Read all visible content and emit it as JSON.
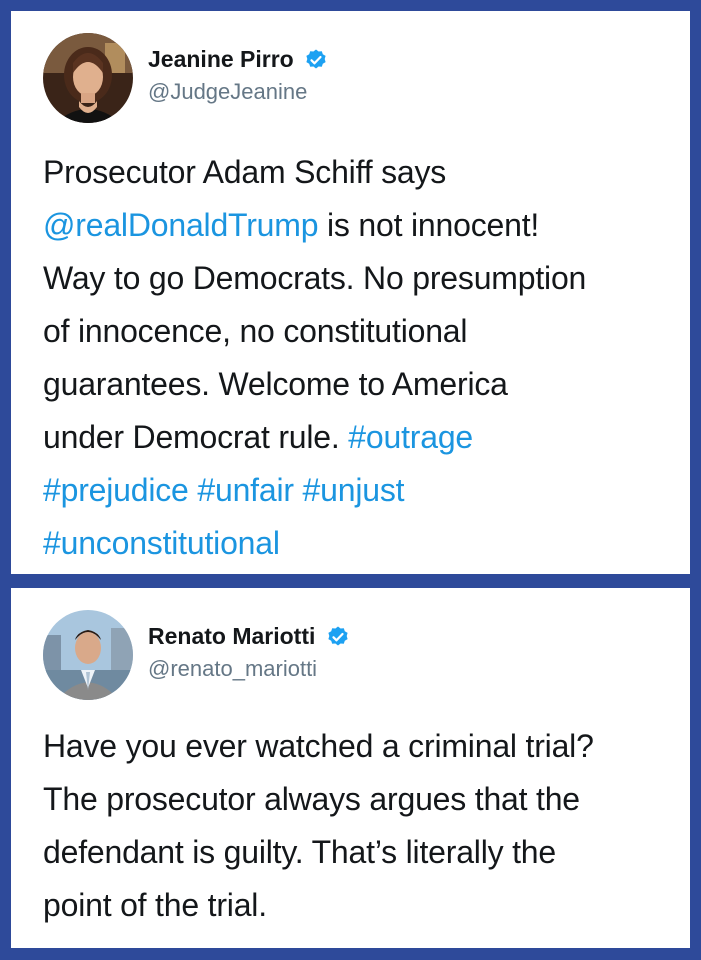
{
  "tweets": [
    {
      "display_name": "Jeanine Pirro",
      "handle": "@JudgeJeanine",
      "verified": true,
      "lines": [
        [
          {
            "t": "Prosecutor Adam Schiff says",
            "link": false
          }
        ],
        [
          {
            "t": "@realDonaldTrump",
            "link": true
          },
          {
            "t": " is not innocent!",
            "link": false
          }
        ],
        [
          {
            "t": "Way to go Democrats. No presumption",
            "link": false
          }
        ],
        [
          {
            "t": "of innocence, no constitutional",
            "link": false
          }
        ],
        [
          {
            "t": "guarantees. Welcome to America",
            "link": false
          }
        ],
        [
          {
            "t": "under Democrat rule. ",
            "link": false
          },
          {
            "t": "#outrage",
            "link": true
          }
        ],
        [
          {
            "t": "#prejudice",
            "link": true
          },
          {
            "t": " ",
            "link": false
          },
          {
            "t": "#unfair",
            "link": true
          },
          {
            "t": " ",
            "link": false
          },
          {
            "t": "#unjust",
            "link": true
          }
        ],
        [
          {
            "t": "#unconstitutional",
            "link": true
          }
        ]
      ]
    },
    {
      "display_name": "Renato Mariotti",
      "handle": "@renato_mariotti",
      "verified": true,
      "lines": [
        [
          {
            "t": "Have you ever watched a criminal trial?",
            "link": false
          }
        ],
        [
          {
            "t": "The prosecutor always argues that the",
            "link": false
          }
        ],
        [
          {
            "t": "defendant is guilty. That’s literally the",
            "link": false
          }
        ],
        [
          {
            "t": "point of the trial.",
            "link": false
          }
        ]
      ]
    }
  ],
  "colors": {
    "background": "#2e4a9a",
    "link": "#1b95e0",
    "verified_badge": "#1da1f2",
    "text": "#14171a",
    "handle": "#657786"
  },
  "icons": {
    "verified": "verified-badge-icon"
  }
}
